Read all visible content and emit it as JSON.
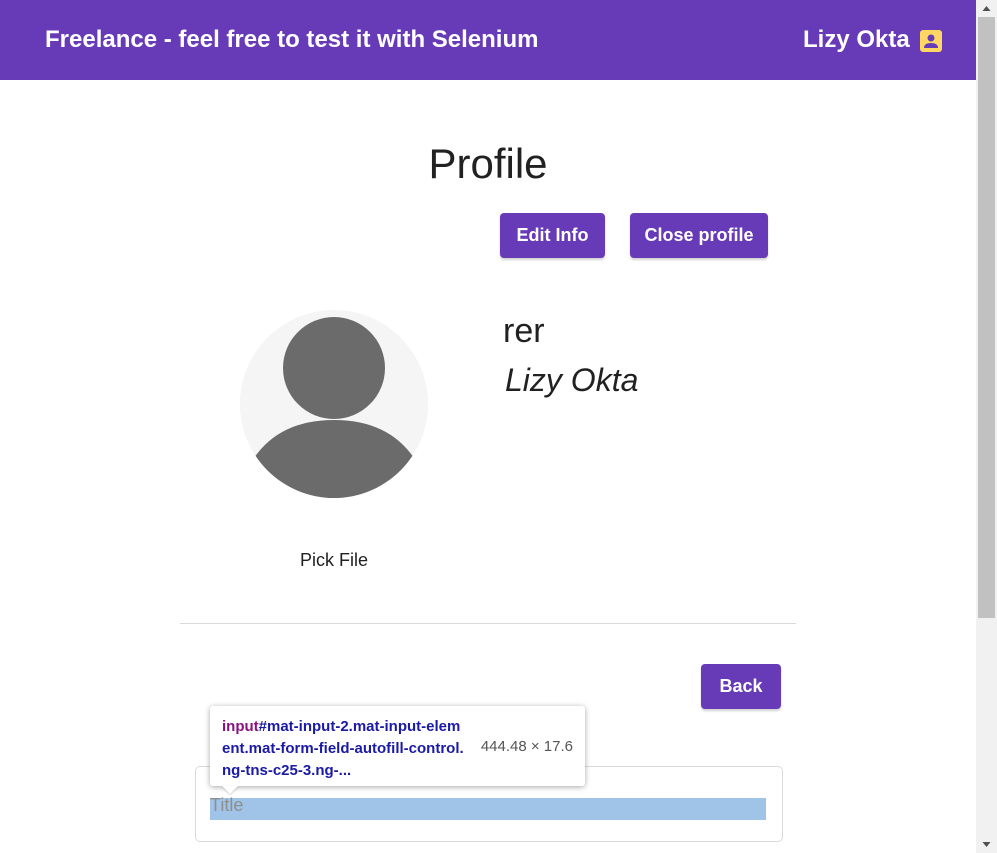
{
  "header": {
    "title": "Freelance - feel free to test it with Selenium",
    "user_name": "Lizy Okta",
    "account_icon": "account-box-icon",
    "background_color": "#673ab7",
    "icon_color": "#fdd663"
  },
  "profile": {
    "heading": "Profile",
    "edit_button_label": "Edit Info",
    "close_button_label": "Close profile",
    "name": "rer",
    "owner": "Lizy Okta",
    "avatar_icon": "person-avatar-icon",
    "pick_file_label": "Pick File"
  },
  "back_button_label": "Back",
  "title_field": {
    "placeholder": "Title",
    "value": ""
  },
  "inspector_tooltip": {
    "tag": "input",
    "selector": "#mat-input-2.mat-input-element.mat-form-field-autofill-control.ng-tns-c25-3.ng-...",
    "size": "444.48 × 17.6"
  },
  "accent_color": "#673ab7"
}
